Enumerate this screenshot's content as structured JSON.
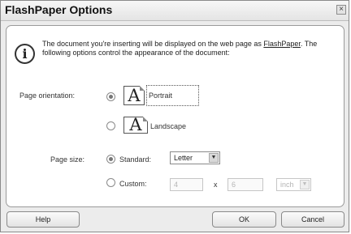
{
  "dialog": {
    "title": "FlashPaper Options",
    "close_glyph": "×"
  },
  "info": {
    "icon_glyph": "i",
    "text_before": "The document you're inserting will be displayed on the web page as ",
    "link": "FlashPaper",
    "text_after": ". The following options control the appearance of the document:"
  },
  "orientation": {
    "label": "Page orientation:",
    "icon_glyph": "A",
    "portrait_label": "Portrait",
    "landscape_label": "Landscape",
    "selected": "Portrait"
  },
  "page_size": {
    "label": "Page size:",
    "standard_label": "Standard:",
    "standard_value": "Letter",
    "custom_label": "Custom:",
    "custom_width": "4",
    "times": "x",
    "custom_height": "6",
    "unit": "inch",
    "selected": "Standard"
  },
  "buttons": {
    "help": "Help",
    "ok": "OK",
    "cancel": "Cancel"
  }
}
